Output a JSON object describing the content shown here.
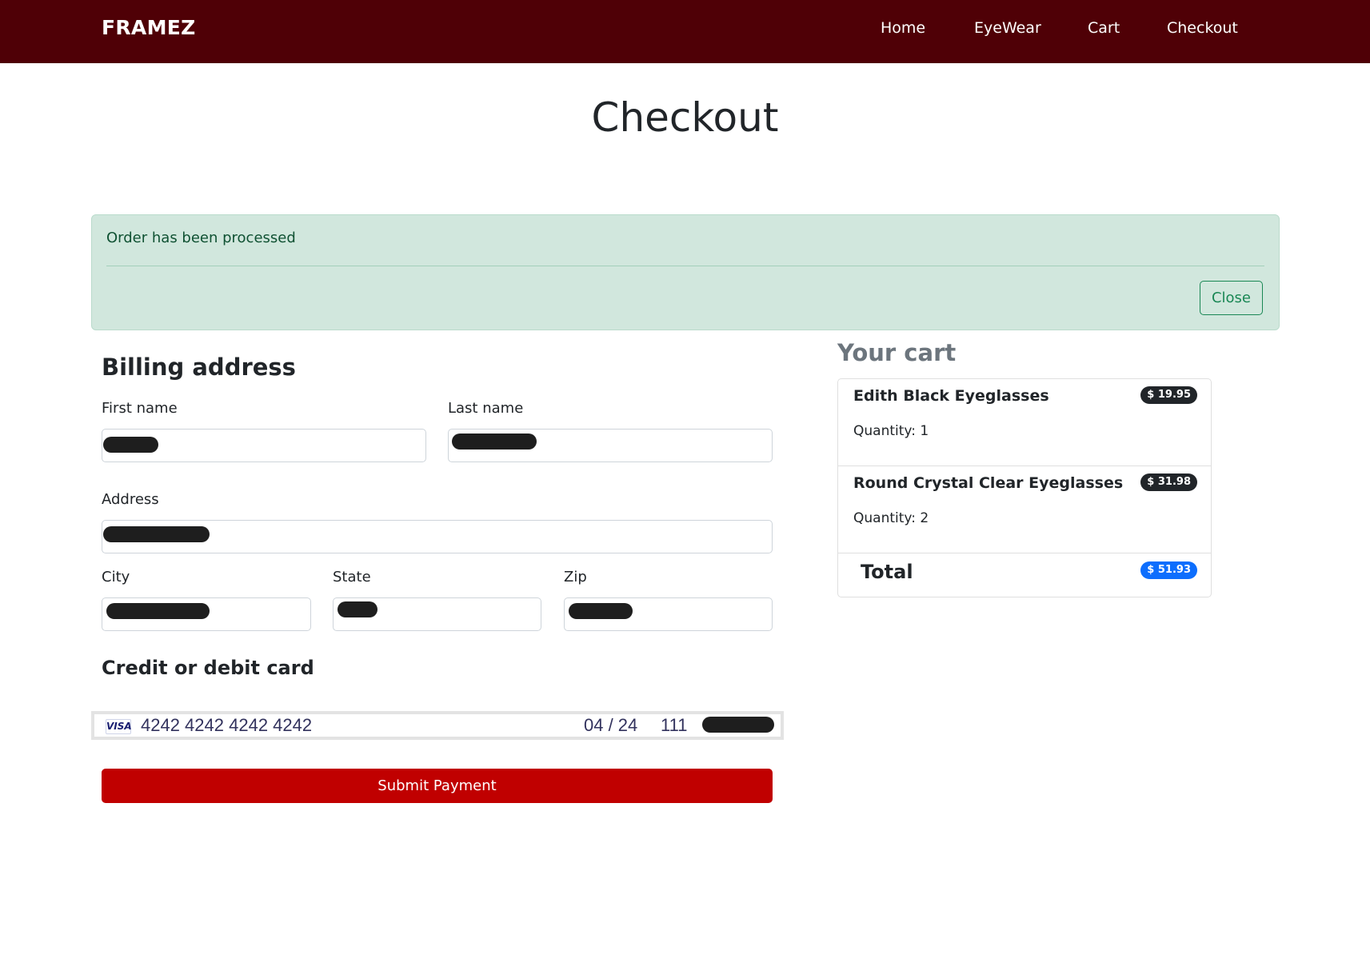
{
  "nav": {
    "brand": "FRAMEZ",
    "links": [
      "Home",
      "EyeWear",
      "Cart",
      "Checkout"
    ]
  },
  "page": {
    "title": "Checkout"
  },
  "alert": {
    "message": "Order has been processed",
    "close_label": "Close"
  },
  "billing": {
    "heading": "Billing address",
    "first_name_label": "First name",
    "last_name_label": "Last name",
    "address_label": "Address",
    "city_label": "City",
    "state_label": "State",
    "zip_label": "Zip"
  },
  "card": {
    "heading": "Credit or debit card",
    "brand": "VISA",
    "number": "4242 4242 4242 4242",
    "expiry": "04 / 24",
    "cvc": "111"
  },
  "submit_label": "Submit Payment",
  "cart": {
    "heading": "Your cart",
    "items": [
      {
        "name": "Edith Black Eyeglasses",
        "quantity": "Quantity: 1",
        "price": "$ 19.95"
      },
      {
        "name": "Round Crystal Clear Eyeglasses",
        "quantity": "Quantity: 2",
        "price": "$ 31.98"
      }
    ],
    "total_label": "Total",
    "total_price": "$ 51.93"
  },
  "colors": {
    "navbar": "#4f0006",
    "submit": "#c00000",
    "alert_bg": "#d1e7dd",
    "alert_text": "#0f5132",
    "total_badge": "#0d6efd"
  }
}
